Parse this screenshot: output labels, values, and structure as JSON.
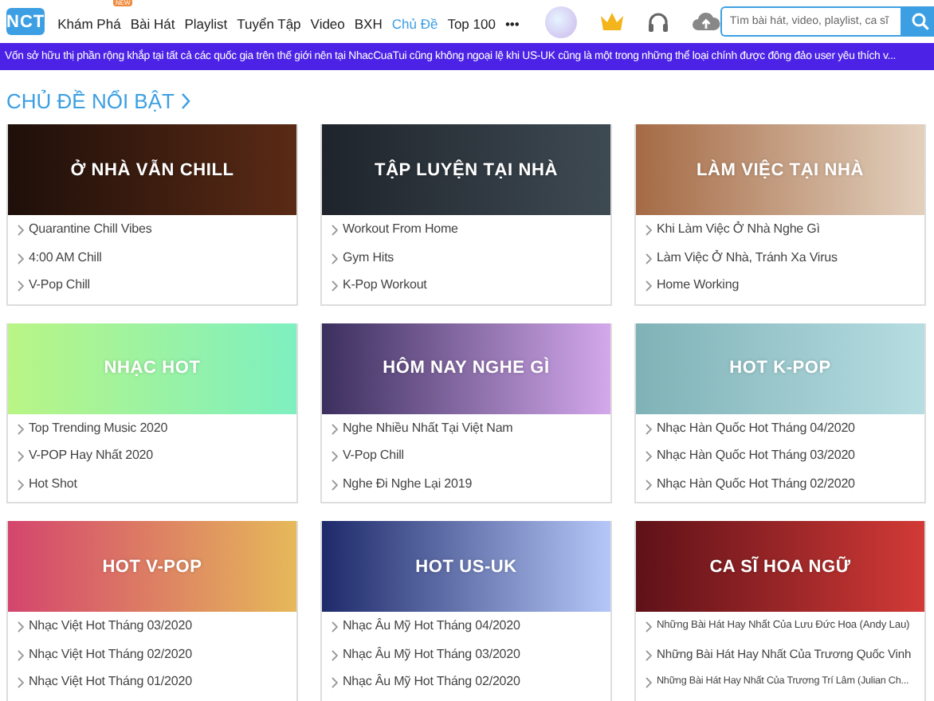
{
  "header": {
    "logo": "NCT",
    "nav": [
      {
        "label": "Khám Phá",
        "selected": false,
        "badge": "NEW"
      },
      {
        "label": "Bài Hát",
        "selected": false
      },
      {
        "label": "Playlist",
        "selected": false
      },
      {
        "label": "Tuyển Tập",
        "selected": false
      },
      {
        "label": "Video",
        "selected": false
      },
      {
        "label": "BXH",
        "selected": false
      },
      {
        "label": "Chủ Đề",
        "selected": true
      },
      {
        "label": "Top 100",
        "selected": false
      },
      {
        "label": "•••",
        "selected": false
      }
    ],
    "search": {
      "placeholder": "Tìm bài hát, video, playlist, ca sĩ"
    }
  },
  "marquee": "Vốn sở hữu thị phần rộng khắp tại tất cả các quốc gia trên thế giới nên tại NhacCuaTui cũng không ngoại lệ khi US-UK cũng là một trong những thể loại chính được đông đảo user yêu thích v...",
  "section_title": "CHỦ ĐỀ NỔI BẬT",
  "topics": [
    {
      "title": "Ở NHÀ VẪN CHILL",
      "items": [
        "Quarantine Chill Vibes",
        "4:00 AM Chill",
        "V-Pop Chill"
      ]
    },
    {
      "title": "TẬP LUYỆN TẠI NHÀ",
      "items": [
        "Workout From Home",
        "Gym Hits",
        "K-Pop Workout"
      ]
    },
    {
      "title": "LÀM VIỆC TẠI NHÀ",
      "items": [
        "Khi Làm Việc Ở Nhà Nghe Gì",
        "Làm Việc Ở Nhà, Tránh Xa Virus",
        "Home Working"
      ]
    },
    {
      "title": "NHẠC HOT",
      "items": [
        "Top Trending Music 2020",
        "V-POP Hay Nhất 2020",
        "Hot Shot"
      ]
    },
    {
      "title": "HÔM NAY NGHE GÌ",
      "items": [
        "Nghe Nhiều Nhất Tại Việt Nam",
        "V-Pop Chill",
        "Nghe Đi Nghe Lại 2019"
      ]
    },
    {
      "title": "HOT K-POP",
      "items": [
        "Nhạc Hàn Quốc Hot Tháng 04/2020",
        "Nhạc Hàn Quốc Hot Tháng 03/2020",
        "Nhạc Hàn Quốc Hot Tháng 02/2020"
      ]
    },
    {
      "title": "HOT V-POP",
      "items": [
        "Nhạc Việt Hot Tháng 03/2020",
        "Nhạc Việt Hot Tháng 02/2020",
        "Nhạc Việt Hot Tháng 01/2020"
      ]
    },
    {
      "title": "HOT US-UK",
      "items": [
        "Nhạc Âu Mỹ Hot Tháng 04/2020",
        "Nhạc Âu Mỹ Hot Tháng 03/2020",
        "Nhạc Âu Mỹ Hot Tháng 02/2020"
      ]
    },
    {
      "title": "CA SĨ HOA NGỮ",
      "items": [
        "Những Bài Hát Hay Nhất Của Lưu Đức Hoa (Andy Lau)",
        "Những Bài Hát Hay Nhất Của Trương Quốc Vinh",
        "Những Bài Hát Hay Nhất Của Trương Trí Lâm (Julian Ch..."
      ]
    }
  ]
}
